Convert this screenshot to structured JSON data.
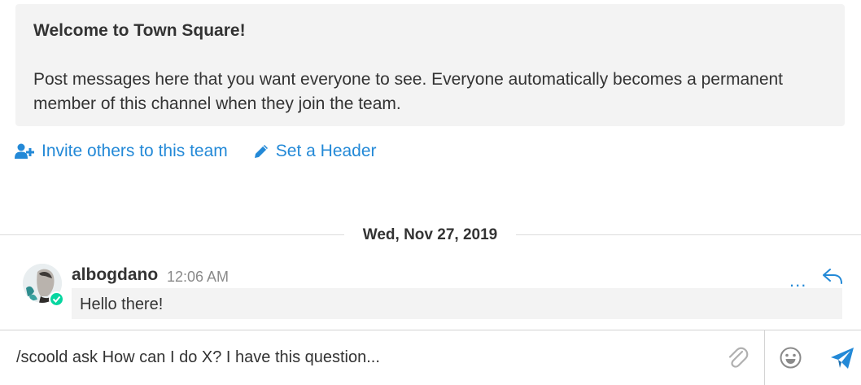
{
  "intro": {
    "title": "Welcome to Town Square!",
    "text": "Post messages here that you want everyone to see. Everyone automatically becomes a permanent member of this channel when they join the team."
  },
  "actions": {
    "invite_label": "Invite others to this team",
    "header_label": "Set a Header",
    "icons": [
      "add-user-icon",
      "pencil-icon"
    ]
  },
  "date_separator": "Wed, Nov 27, 2019",
  "post": {
    "username": "albogdano",
    "time": "12:06 AM",
    "message": "Hello there!",
    "more_label": "...",
    "status": "online"
  },
  "composer": {
    "value": "/scoold ask How can I do X? I have this question...",
    "icons": [
      "paperclip-icon",
      "emoji-icon",
      "send-icon"
    ]
  },
  "colors": {
    "link": "#2389d7",
    "online": "#06d6a0",
    "box_bg": "#f3f3f3"
  }
}
